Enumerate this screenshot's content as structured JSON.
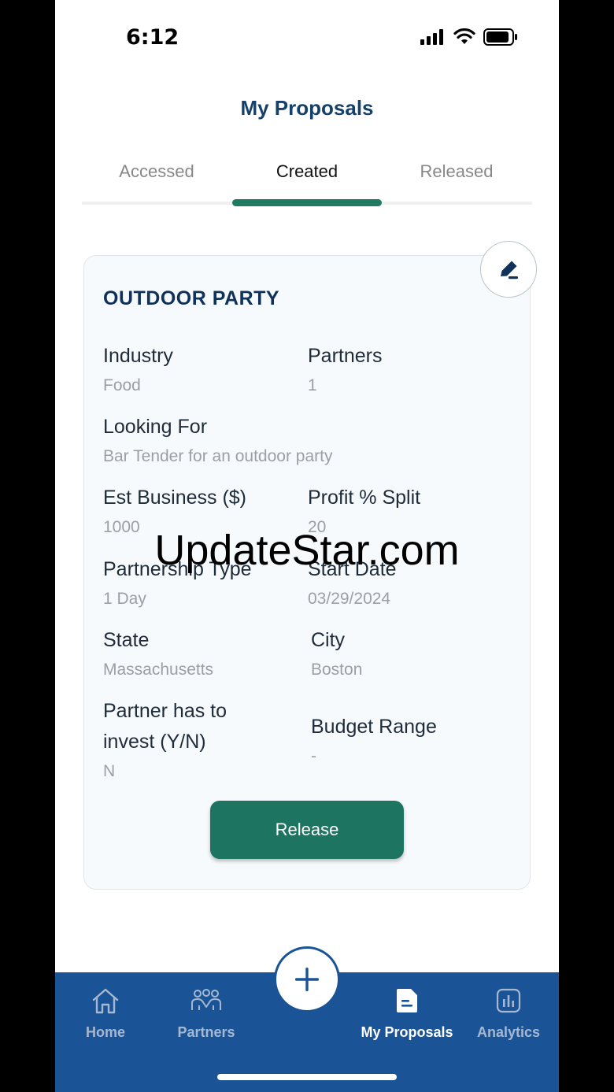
{
  "status_bar": {
    "time": "6:12"
  },
  "page": {
    "title": "My Proposals"
  },
  "tabs": [
    {
      "label": "Accessed"
    },
    {
      "label": "Created"
    },
    {
      "label": "Released"
    }
  ],
  "active_tab": "Created",
  "card": {
    "title": "OUTDOOR PARTY",
    "fields": {
      "industry": {
        "label": "Industry",
        "value": "Food"
      },
      "partners": {
        "label": "Partners",
        "value": "1"
      },
      "looking_for": {
        "label": "Looking For",
        "value": "Bar Tender for an outdoor party"
      },
      "est_business": {
        "label": "Est Business ($)",
        "value": "1000"
      },
      "profit_split": {
        "label": "Profit % Split",
        "value": "20"
      },
      "partnership_type": {
        "label": "Partnership Type",
        "value": "1 Day"
      },
      "start_date": {
        "label": "Start Date",
        "value": "03/29/2024"
      },
      "state": {
        "label": "State",
        "value": "Massachusetts"
      },
      "city": {
        "label": "City",
        "value": "Boston"
      },
      "invest": {
        "label_line1": "Partner has to",
        "label_line2": "invest (Y/N)",
        "value": "N"
      },
      "budget_range": {
        "label": "Budget Range",
        "value": "-"
      }
    },
    "release_label": "Release"
  },
  "watermark": "UpdateStar.com",
  "nav": {
    "home": "Home",
    "partners": "Partners",
    "my_proposals": "My Proposals",
    "analytics": "Analytics"
  },
  "colors": {
    "brand_blue": "#1a5496",
    "accent_green": "#1d7b62",
    "title_navy": "#15406b"
  },
  "icons": {
    "edit": "pencil-icon",
    "add": "plus-icon",
    "home": "home-icon",
    "partners": "people-icon",
    "proposals": "document-icon",
    "analytics": "chart-icon"
  }
}
